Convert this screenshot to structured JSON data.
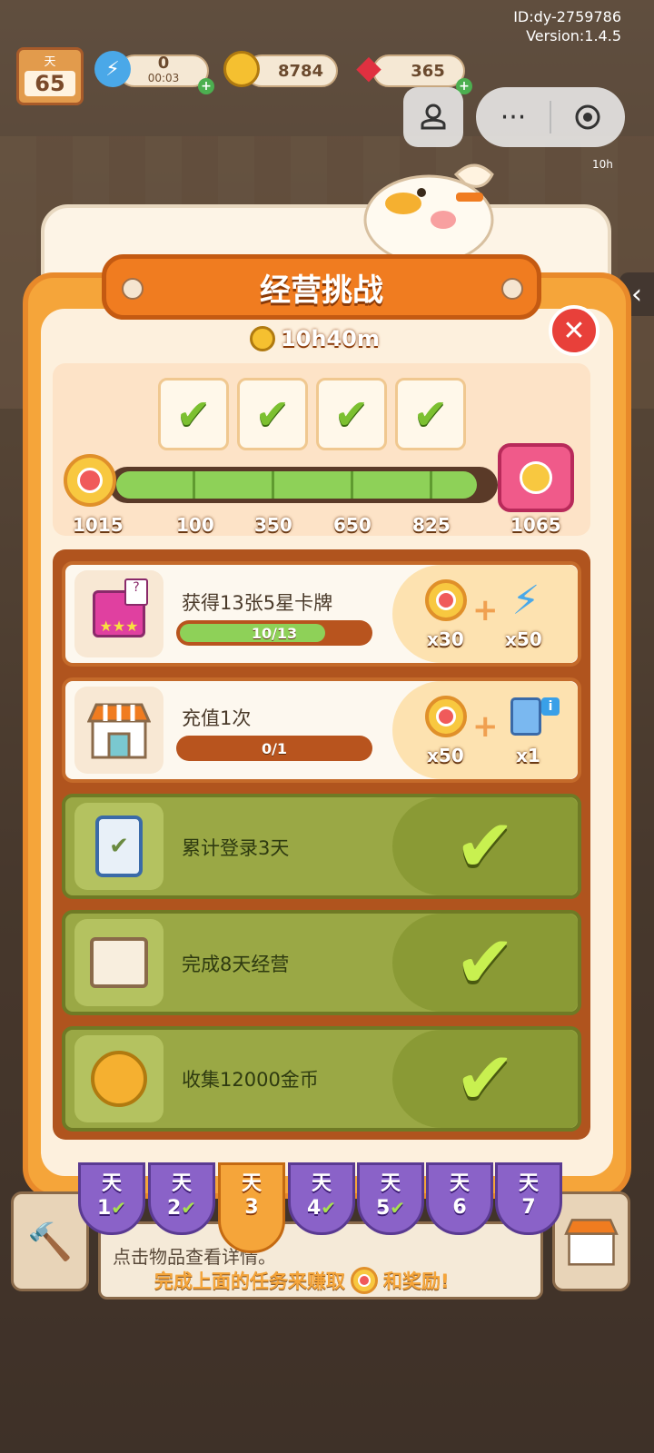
{
  "hud": {
    "user_id": "ID:dy-2759786",
    "version": "Version:1.4.5",
    "day_label": "天",
    "day_number": "65",
    "energy_value": "0",
    "energy_timer": "00:03",
    "coins": "8784",
    "gems": "365",
    "side_timer": "10h"
  },
  "panel": {
    "title": "经营挑战",
    "timer": "10h40m"
  },
  "milestones": {
    "current_points": "1015",
    "labels": [
      "100",
      "350",
      "650",
      "825"
    ],
    "goal_points": "1065",
    "progress_fraction": 0.95
  },
  "tasks": [
    {
      "name": "获得13张5星卡牌",
      "progress": "10/13",
      "progress_fraction": 0.77,
      "rewards": [
        {
          "icon": "medal-icon",
          "qty": "x30"
        },
        {
          "icon": "energy-bolt-icon",
          "qty": "x50"
        }
      ]
    },
    {
      "name": "充值1次",
      "progress": "0/1",
      "progress_fraction": 0,
      "rewards": [
        {
          "icon": "medal-icon",
          "qty": "x50"
        },
        {
          "icon": "card-pack-icon",
          "qty": "x1"
        }
      ]
    },
    {
      "name": "累计登录3天"
    },
    {
      "name": "完成8天经营"
    },
    {
      "name": "收集12000金币"
    }
  ],
  "day_tabs": [
    {
      "label": "天",
      "num": "1",
      "done": true
    },
    {
      "label": "天",
      "num": "2",
      "done": true
    },
    {
      "label": "天",
      "num": "3",
      "active": true
    },
    {
      "label": "天",
      "num": "4",
      "done": true
    },
    {
      "label": "天",
      "num": "5",
      "done": true
    },
    {
      "label": "天",
      "num": "6"
    },
    {
      "label": "天",
      "num": "7"
    }
  ],
  "footer": {
    "hint_info": "点击物品查看详情。",
    "hint_task_prefix": "完成上面的任务来赚取",
    "hint_task_suffix": "和奖励!"
  },
  "misc": {
    "info_badge": "i",
    "card_question": "?",
    "stars": "★★★",
    "plus": "+",
    "check_glyph": "✔",
    "close_glyph": "✕",
    "more_glyph": "···",
    "back_glyph": "‹"
  }
}
